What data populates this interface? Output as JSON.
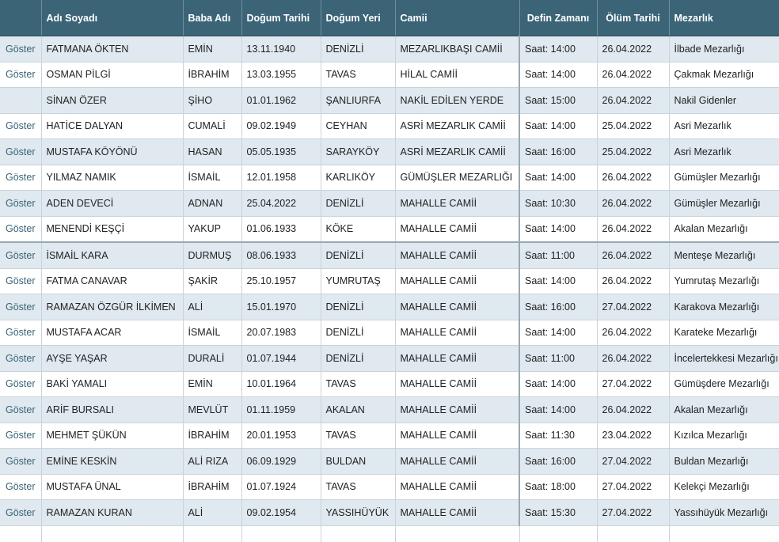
{
  "headers": {
    "show": "",
    "name": "Adı Soyadı",
    "father": "Baba Adı",
    "birth_date": "Doğum Tarihi",
    "birth_place": "Doğum Yeri",
    "mosque": "Camii",
    "burial_time": "Defin Zamanı",
    "death_date": "Ölüm Tarihi",
    "cemetery": "Mezarlık"
  },
  "rows": [
    {
      "show": "Göster",
      "name": "FATMANA ÖKTEN",
      "father": "EMİN",
      "birth_date": "13.11.1940",
      "birth_place": "DENİZLİ",
      "mosque": "MEZARLIKBAŞI CAMİİ",
      "burial_time": "Saat: 14:00",
      "death_date": "26.04.2022",
      "cemetery": "İlbade Mezarlığı"
    },
    {
      "show": "Göster",
      "name": "OSMAN PİLGİ",
      "father": "İBRAHİM",
      "birth_date": "13.03.1955",
      "birth_place": "TAVAS",
      "mosque": "HİLAL CAMİİ",
      "burial_time": "Saat: 14:00",
      "death_date": "26.04.2022",
      "cemetery": "Çakmak Mezarlığı"
    },
    {
      "show": "",
      "name": "SİNAN ÖZER",
      "father": "ŞİHO",
      "birth_date": "01.01.1962",
      "birth_place": "ŞANLIURFA",
      "mosque": "NAKİL EDİLEN YERDE",
      "burial_time": "Saat: 15:00",
      "death_date": "26.04.2022",
      "cemetery": "Nakil Gidenler"
    },
    {
      "show": "Göster",
      "name": "HATİCE DALYAN",
      "father": "CUMALİ",
      "birth_date": "09.02.1949",
      "birth_place": "CEYHAN",
      "mosque": "ASRİ MEZARLIK CAMİİ",
      "burial_time": "Saat: 14:00",
      "death_date": "25.04.2022",
      "cemetery": "Asri Mezarlık"
    },
    {
      "show": "Göster",
      "name": "MUSTAFA KÖYÖNÜ",
      "father": "HASAN",
      "birth_date": "05.05.1935",
      "birth_place": "SARAYKÖY",
      "mosque": "ASRİ MEZARLIK CAMİİ",
      "burial_time": "Saat: 16:00",
      "death_date": "25.04.2022",
      "cemetery": "Asri Mezarlık"
    },
    {
      "show": "Göster",
      "name": "YILMAZ NAMIK",
      "father": "İSMAİL",
      "birth_date": "12.01.1958",
      "birth_place": "KARLIKÖY",
      "mosque": "GÜMÜŞLER MEZARLIĞI",
      "burial_time": "Saat: 14:00",
      "death_date": "26.04.2022",
      "cemetery": "Gümüşler Mezarlığı"
    },
    {
      "show": "Göster",
      "name": "ADEN DEVECİ",
      "father": "ADNAN",
      "birth_date": "25.04.2022",
      "birth_place": "DENİZLİ",
      "mosque": "MAHALLE CAMİİ",
      "burial_time": "Saat: 10:30",
      "death_date": "26.04.2022",
      "cemetery": "Gümüşler Mezarlığı"
    },
    {
      "show": "Göster",
      "name": "MENENDİ KEŞÇİ",
      "father": "YAKUP",
      "birth_date": "01.06.1933",
      "birth_place": "KÖKE",
      "mosque": "MAHALLE CAMİİ",
      "burial_time": "Saat: 14:00",
      "death_date": "26.04.2022",
      "cemetery": "Akalan Mezarlığı"
    },
    {
      "show": "Göster",
      "name": "İSMAİL KARA",
      "father": "DURMUŞ",
      "birth_date": "08.06.1933",
      "birth_place": "DENİZLİ",
      "mosque": "MAHALLE CAMİİ",
      "burial_time": "Saat: 11:00",
      "death_date": "26.04.2022",
      "cemetery": "Menteşe Mezarlığı"
    },
    {
      "show": "Göster",
      "name": "FATMA CANAVAR",
      "father": "ŞAKİR",
      "birth_date": "25.10.1957",
      "birth_place": "YUMRUTAŞ",
      "mosque": "MAHALLE CAMİİ",
      "burial_time": "Saat: 14:00",
      "death_date": "26.04.2022",
      "cemetery": "Yumrutaş Mezarlığı"
    },
    {
      "show": "Göster",
      "name": "RAMAZAN ÖZGÜR İLKİMEN",
      "father": "ALİ",
      "birth_date": "15.01.1970",
      "birth_place": "DENİZLİ",
      "mosque": "MAHALLE CAMİİ",
      "burial_time": "Saat: 16:00",
      "death_date": "27.04.2022",
      "cemetery": "Karakova Mezarlığı"
    },
    {
      "show": "Göster",
      "name": "MUSTAFA ACAR",
      "father": "İSMAİL",
      "birth_date": "20.07.1983",
      "birth_place": "DENİZLİ",
      "mosque": "MAHALLE CAMİİ",
      "burial_time": "Saat: 14:00",
      "death_date": "26.04.2022",
      "cemetery": "Karateke Mezarlığı"
    },
    {
      "show": "Göster",
      "name": "AYŞE YAŞAR",
      "father": "DURALİ",
      "birth_date": "01.07.1944",
      "birth_place": "DENİZLİ",
      "mosque": "MAHALLE CAMİİ",
      "burial_time": "Saat: 11:00",
      "death_date": "26.04.2022",
      "cemetery": "İncelertekkesi Mezarlığı"
    },
    {
      "show": "Göster",
      "name": "BAKİ YAMALI",
      "father": "EMİN",
      "birth_date": "10.01.1964",
      "birth_place": "TAVAS",
      "mosque": "MAHALLE CAMİİ",
      "burial_time": "Saat: 14:00",
      "death_date": "27.04.2022",
      "cemetery": "Gümüşdere Mezarlığı"
    },
    {
      "show": "Göster",
      "name": "ARİF BURSALI",
      "father": "MEVLÜT",
      "birth_date": "01.11.1959",
      "birth_place": "AKALAN",
      "mosque": "MAHALLE CAMİİ",
      "burial_time": "Saat: 14:00",
      "death_date": "26.04.2022",
      "cemetery": "Akalan Mezarlığı"
    },
    {
      "show": "Göster",
      "name": "MEHMET ŞÜKÜN",
      "father": "İBRAHİM",
      "birth_date": "20.01.1953",
      "birth_place": "TAVAS",
      "mosque": "MAHALLE CAMİİ",
      "burial_time": "Saat: 11:30",
      "death_date": "23.04.2022",
      "cemetery": "Kızılca Mezarlığı"
    },
    {
      "show": "Göster",
      "name": "EMİNE KESKİN",
      "father": "ALİ RIZA",
      "birth_date": "06.09.1929",
      "birth_place": "BULDAN",
      "mosque": "MAHALLE CAMİİ",
      "burial_time": "Saat: 16:00",
      "death_date": "27.04.2022",
      "cemetery": "Buldan Mezarlığı"
    },
    {
      "show": "Göster",
      "name": "MUSTAFA ÜNAL",
      "father": "İBRAHİM",
      "birth_date": "01.07.1924",
      "birth_place": "TAVAS",
      "mosque": "MAHALLE CAMİİ",
      "burial_time": "Saat: 18:00",
      "death_date": "27.04.2022",
      "cemetery": "Kelekçi Mezarlığı"
    },
    {
      "show": "Göster",
      "name": "RAMAZAN KURAN",
      "father": "ALİ",
      "birth_date": "09.02.1954",
      "birth_place": "YASSIHÜYÜK",
      "mosque": "MAHALLE CAMİİ",
      "burial_time": "Saat: 15:30",
      "death_date": "27.04.2022",
      "cemetery": "Yassıhüyük Mezarlığı"
    }
  ],
  "colors": {
    "header_bg": "#3b6477",
    "row_alt_bg": "#dfe9ef",
    "link": "#3b6477"
  }
}
